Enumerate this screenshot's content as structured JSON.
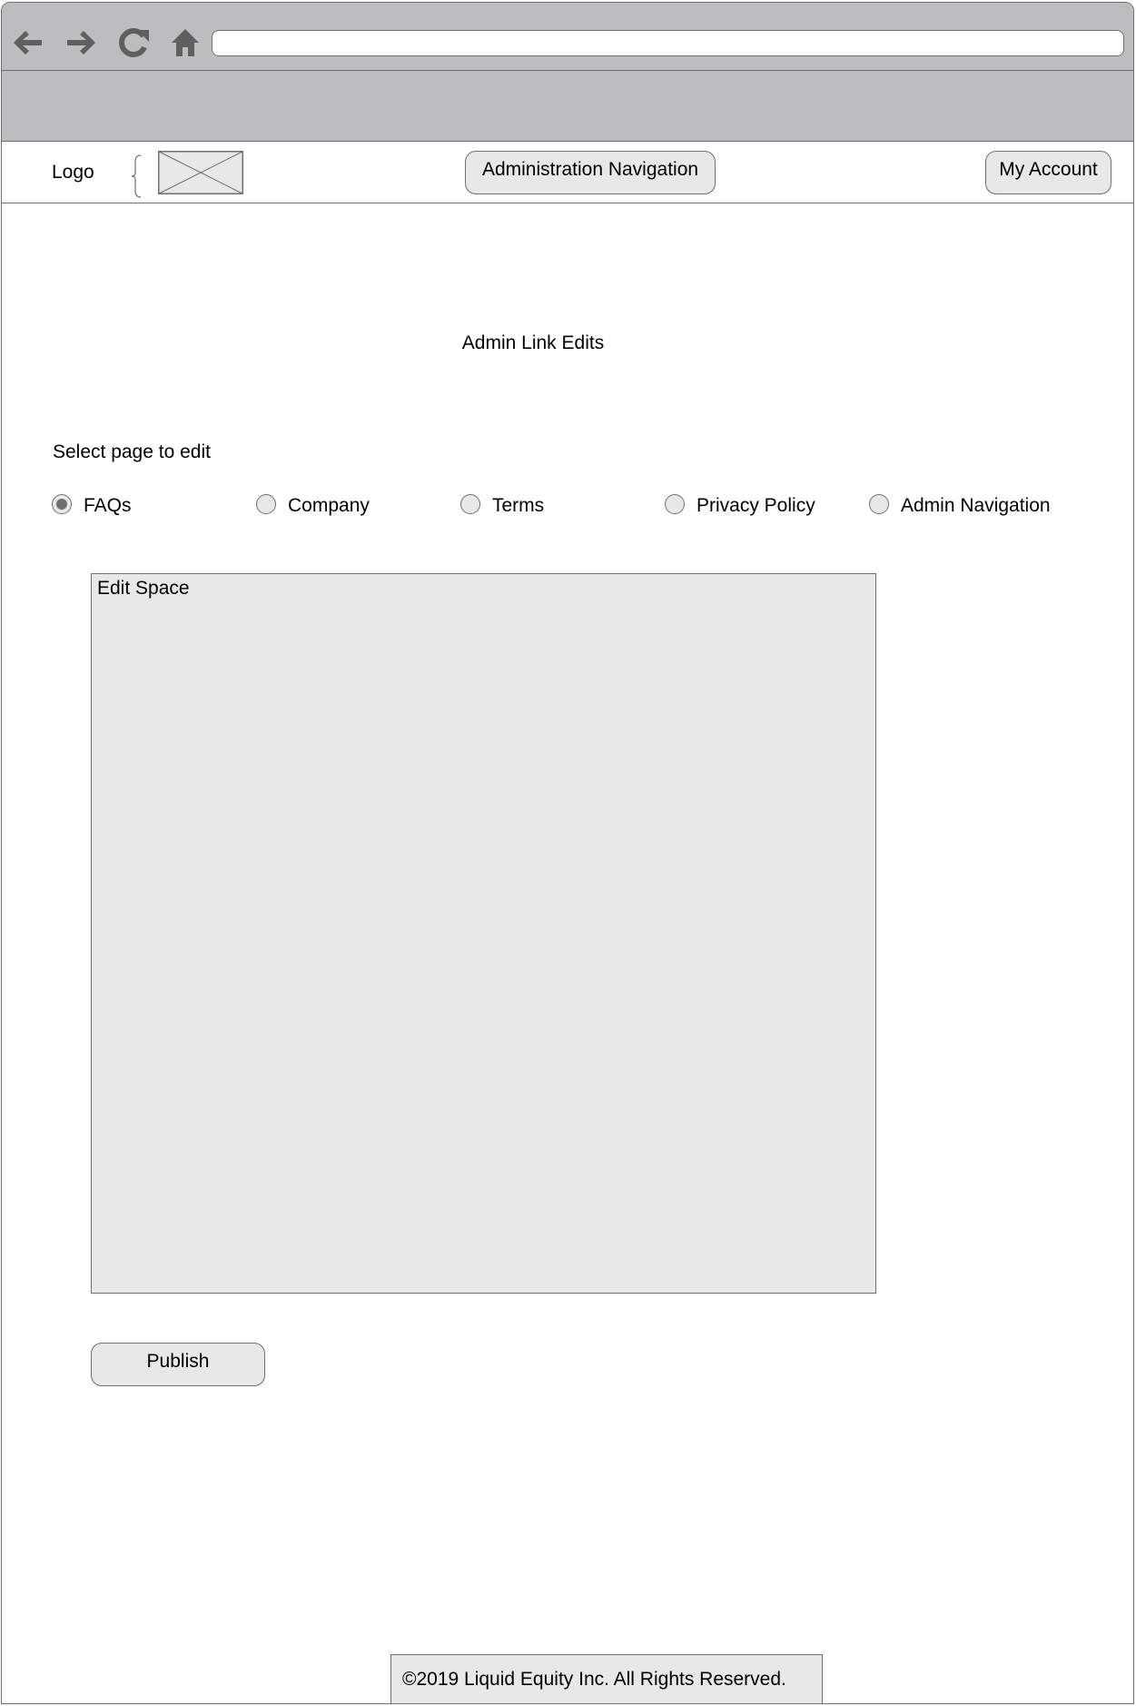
{
  "browser": {
    "icons": [
      "back-arrow-icon",
      "forward-arrow-icon",
      "reload-icon",
      "home-icon"
    ],
    "address": ""
  },
  "header": {
    "logo_label": "Logo",
    "admin_nav_label": "Administration Navigation",
    "account_label": "My Account"
  },
  "main": {
    "title": "Admin Link Edits",
    "select_label": "Select page to edit",
    "options": [
      {
        "label": "FAQs",
        "selected": true
      },
      {
        "label": "Company",
        "selected": false
      },
      {
        "label": "Terms",
        "selected": false
      },
      {
        "label": "Privacy Policy",
        "selected": false
      },
      {
        "label": "Admin Navigation",
        "selected": false
      }
    ],
    "edit_space_label": "Edit Space",
    "publish_label": "Publish"
  },
  "footer": {
    "text": "©2019 Liquid Equity Inc. All Rights Reserved."
  },
  "colors": {
    "chrome_gray": "#bcbdbf",
    "control_fill": "#e8e8e8",
    "stroke": "#6f6f6f",
    "icon": "#5f5f5f"
  }
}
